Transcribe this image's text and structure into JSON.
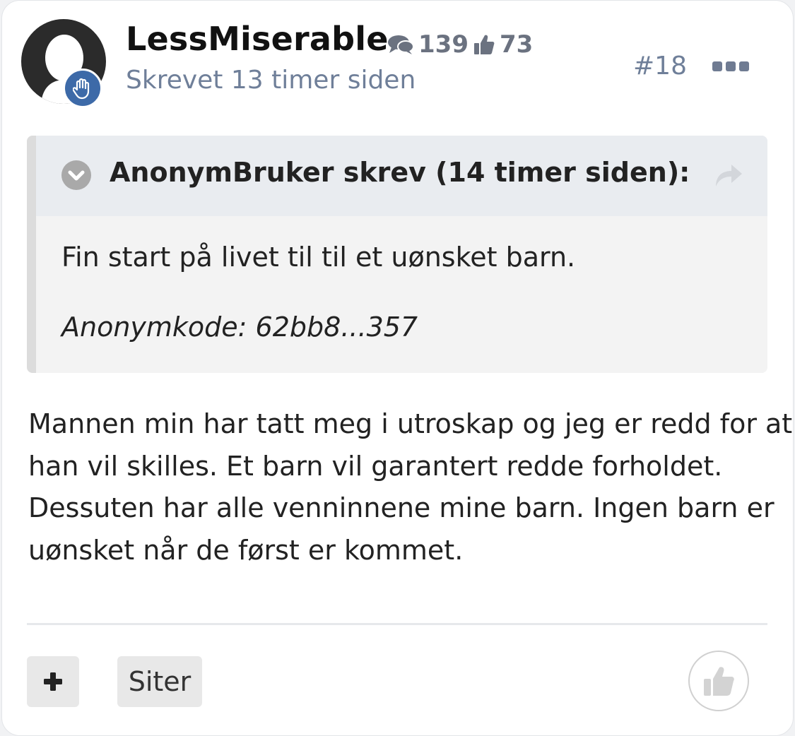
{
  "post": {
    "author": {
      "name": "LessMiserable",
      "posts_count": "139",
      "likes_count": "73"
    },
    "posted_label": "Skrevet 13 timer siden",
    "number": "#18",
    "quote": {
      "header": "AnonymBruker skrev (14 timer siden):",
      "text": "Fin start på livet til til et uønsket barn.",
      "anon_code": "Anonymkode: 62bb8...357"
    },
    "body_lines": [
      "Mannen min har tatt meg i utroskap og jeg er redd for at",
      "han vil skilles. Et barn vil garantert redde forholdet.",
      "Dessuten har alle venninnene mine barn. Ingen barn er",
      "uønsket når de først er kommet."
    ],
    "actions": {
      "quote_label": "Siter"
    }
  },
  "icons": {
    "avatar": "default-user-avatar",
    "badge": "hand-icon",
    "posts": "chat-bubbles-icon",
    "likes": "thumbs-up-icon",
    "more": "ellipsis-icon",
    "toggle": "chevron-down-icon",
    "share": "share-arrow-icon",
    "plus": "plus-icon",
    "like": "thumbs-up-icon"
  },
  "colors": {
    "accent": "#3d6aa8",
    "meta_text": "#6f7f99"
  }
}
